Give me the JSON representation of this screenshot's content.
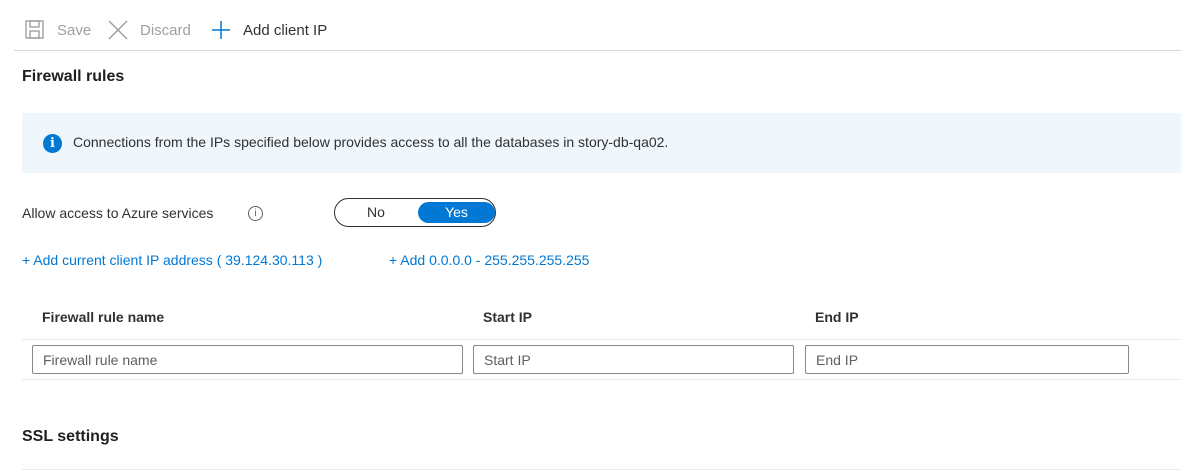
{
  "toolbar": {
    "save_label": "Save",
    "discard_label": "Discard",
    "add_client_ip_label": "Add client IP"
  },
  "firewall": {
    "title": "Firewall rules",
    "info_text": "Connections from the IPs specified below provides access to all the databases in story-db-qa02.",
    "allow_label": "Allow access to Azure services",
    "toggle": {
      "no": "No",
      "yes": "Yes",
      "selected": "Yes"
    },
    "add_current_ip_link": "+ Add current client IP address ( 39.124.30.113 )",
    "add_range_link": "+ Add 0.0.0.0 - 255.255.255.255",
    "table": {
      "headers": [
        "Firewall rule name",
        "Start IP",
        "End IP"
      ],
      "placeholders": [
        "Firewall rule name",
        "Start IP",
        "End IP"
      ]
    }
  },
  "ssl": {
    "title": "SSL settings"
  },
  "colors": {
    "accent": "#0078d4",
    "info_bg": "#eff6fc",
    "disabled_text": "#a19f9d"
  },
  "icons": {
    "save": "save-icon",
    "discard": "close-icon",
    "add": "plus-icon",
    "info": "info-icon",
    "help": "help-icon"
  }
}
